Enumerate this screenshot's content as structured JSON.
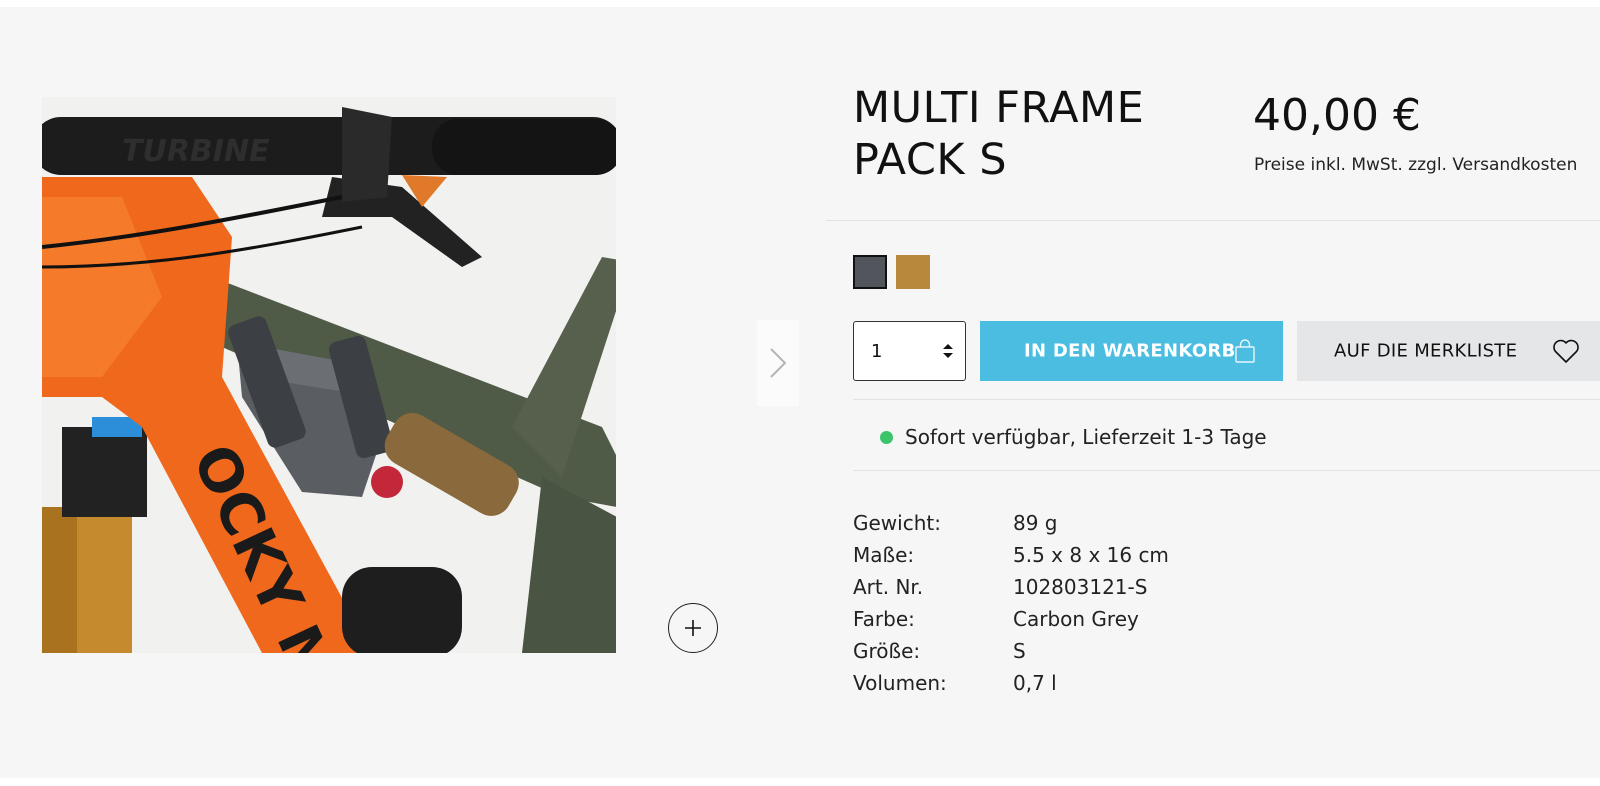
{
  "product": {
    "title_line1": "MULTI FRAME",
    "title_line2": "PACK S",
    "price": "40,00 €",
    "price_note": "Preise inkl. MwSt. zzgl. Versandkosten",
    "swatches": [
      {
        "name": "Carbon Grey",
        "color": "#52555b",
        "selected": true
      },
      {
        "name": "gold",
        "color": "#b8893d",
        "selected": false
      }
    ]
  },
  "purchase": {
    "quantity": "1",
    "cart_label": "IN DEN WARENKORB",
    "wishlist_label": "AUF DIE MERKLISTE",
    "accent_color": "#4bbde0"
  },
  "availability": {
    "text": "Sofort verfügbar, Lieferzeit 1-3 Tage",
    "status_color": "#3cc46a"
  },
  "specs": [
    {
      "label": "Gewicht:",
      "value": "89 g"
    },
    {
      "label": "Maße:",
      "value": "5.5 x 8 x 16 cm"
    },
    {
      "label": "Art. Nr.",
      "value": "102803121-S"
    },
    {
      "label": "Farbe:",
      "value": "Carbon Grey"
    },
    {
      "label": "Größe:",
      "value": "S"
    },
    {
      "label": "Volumen:",
      "value": "0,7 l"
    }
  ],
  "icons": {
    "next": "chevron-right-icon",
    "zoom": "plus-icon",
    "cart": "shopping-bag-icon",
    "wishlist": "heart-icon",
    "quantity": "updown-arrows-icon"
  }
}
